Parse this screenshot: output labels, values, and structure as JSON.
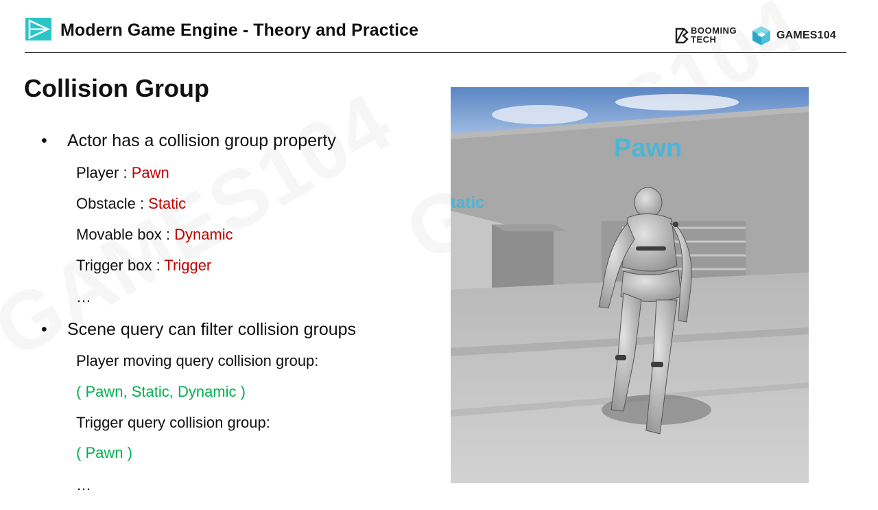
{
  "header": {
    "course_title": "Modern Game Engine - Theory and Practice",
    "brand_booming_line1": "BOOMING",
    "brand_booming_line2": "TECH",
    "brand_games": "GAMES104"
  },
  "slide": {
    "title": "Collision Group",
    "bullets": [
      {
        "text": "Actor has a collision group property",
        "items": [
          {
            "label": "Player : ",
            "value": "Pawn"
          },
          {
            "label": "Obstacle : ",
            "value": "Static"
          },
          {
            "label": "Movable box : ",
            "value": "Dynamic"
          },
          {
            "label": "Trigger box : ",
            "value": "Trigger"
          }
        ],
        "ellipsis": "…"
      },
      {
        "text": "Scene query can filter collision groups",
        "lines": [
          "Player moving query collision group:",
          "( Pawn, Static, Dynamic )",
          "Trigger query collision group:",
          "( Pawn )"
        ],
        "ellipsis": "…"
      }
    ],
    "bullet_char": "•"
  },
  "scene": {
    "wall_label_pawn": "Pawn",
    "wall_label_static": "tatic"
  },
  "colors": {
    "accent": "#2bc4c9",
    "value_red": "#c00000",
    "group_green": "#00b050",
    "scene_label": "#4bb6d6"
  }
}
